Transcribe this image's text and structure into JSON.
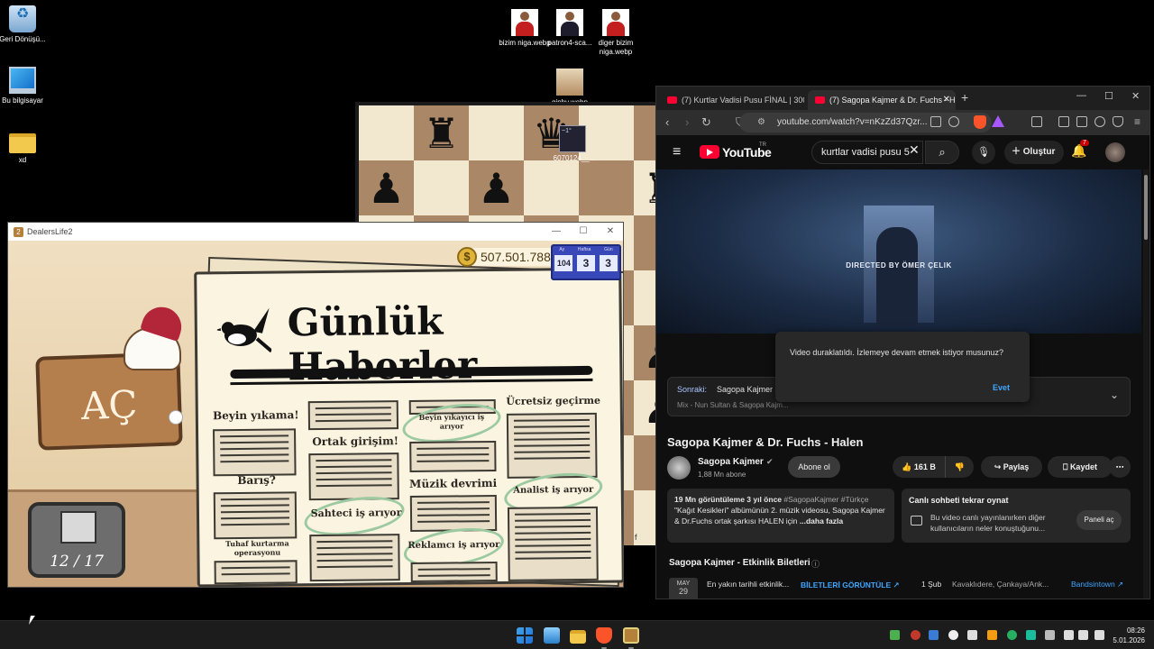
{
  "desktop": {
    "icons": [
      {
        "label": "Geri Dönüşü...",
        "icon": "recycle-bin-icon"
      },
      {
        "label": "Bu bilgisayar",
        "icon": "computer-icon"
      },
      {
        "label": "xd",
        "icon": "folder-icon"
      },
      {
        "label": "bizim niga.webp",
        "icon": "image-file-icon"
      },
      {
        "label": "patron4-sca...",
        "icon": "image-file-icon"
      },
      {
        "label": "diger bizim niga.webp",
        "icon": "image-file-icon"
      },
      {
        "label": "giphy.webp",
        "icon": "image-file-icon"
      }
    ]
  },
  "chess_window": {
    "thumb_label": "6070124__...",
    "thumb_badge": "~1°",
    "footer": "f",
    "board": [
      [
        "",
        "♜",
        "",
        "♛",
        "",
        ""
      ],
      [
        "♟",
        "",
        "♟",
        "",
        "",
        "♜"
      ],
      [
        "",
        "",
        "",
        "",
        "",
        ""
      ],
      [
        "",
        "",
        "",
        "",
        "",
        ""
      ],
      [
        "",
        "",
        "",
        "",
        "",
        "♟"
      ],
      [
        "",
        "",
        "",
        "",
        "",
        "♟"
      ],
      [
        "",
        "",
        "",
        "",
        "",
        ""
      ],
      [
        "",
        "",
        "",
        "",
        "",
        ""
      ]
    ]
  },
  "dealerslife": {
    "title": "DealersLife2",
    "window_controls": {
      "minimize": "—",
      "maximize": "☐",
      "close": "✕"
    },
    "money_symbol": "$",
    "money": "507.501.788",
    "calendar": {
      "labels": [
        "Ay",
        "Haftsa",
        "Gün"
      ],
      "values": [
        "104",
        "3",
        "3"
      ]
    },
    "open_sign": "AÇ",
    "inventory_count": "12 / 17",
    "newspaper": {
      "title": "Günlük Haberler",
      "headlines": [
        "Beyin yıkama!",
        "Ortak girişim!",
        "Beyin yıkayıcı iş arıyor",
        "Ücretsiz geçirme",
        "Barış?",
        "Müzik devrimi",
        "Sahteci iş arıyor",
        "Analist iş arıyor",
        "Tuhaf kurtarma operasyonu",
        "Reklamcı iş arıyor"
      ]
    }
  },
  "browser": {
    "tabs": [
      {
        "label": "(7) Kurtlar Vadisi Pusu FİNAL | 300. Bö",
        "active": false
      },
      {
        "label": "(7) Sagopa Kajmer & Dr. Fuchs - H",
        "active": true
      }
    ],
    "new_tab": "+",
    "window_controls": {
      "minimize": "—",
      "maximize": "☐",
      "close": "✕"
    },
    "url": "youtube.com/watch?v=nKzZd37Qzr...",
    "youtube": {
      "brand": "YouTube",
      "region": "TR",
      "search_value": "kurtlar vadisi pusu 5",
      "create_label": "Oluştur",
      "notif_count": "7",
      "video_overlay": "DIRECTED BY ÖMER ÇELIK",
      "next_label": "Sonraki:",
      "next_title": "Sagopa Kajmer - S",
      "next_sub": "Mix - Nun Sultan & Sagopa Kajm...",
      "pause_prompt": "Video duraklatıldı. İzlemeye devam etmek istiyor musunuz?",
      "pause_yes": "Evet",
      "video_title": "Sagopa Kajmer & Dr. Fuchs - Halen",
      "channel": "Sagopa Kajmer",
      "subscribers": "1,88 Mn abone",
      "subscribe": "Abone ol",
      "likes": "161 B",
      "share": "Paylaş",
      "save": "Kaydet",
      "desc_stats": "19 Mn görüntüleme  3 yıl önce",
      "desc_tags": "#SagopaKajmer #Türkçe",
      "desc_body": "\"Kağıt Kesikleri\" albümünün 2. müzik videosu, Sagopa Kajmer & Dr.Fuchs ortak şarkısı HALEN için",
      "desc_more": "...daha fazla",
      "chat_title": "Canlı sohbeti tekrar oynat",
      "chat_text": "Bu video canlı yayınlanırken diğer kullanıcıların neler konuştuğunu...",
      "chat_button": "Paneli aç",
      "events_title": "Sagopa Kajmer - Etkinlik Biletleri",
      "event_month": "MAY",
      "event_day": "29",
      "event_text": "En yakın tarihli etkinlik...",
      "event_button": "BİLETLERİ GÖRÜNTÜLE ↗",
      "event2_date": "1 Şub",
      "event2_place": "Kavaklıdere, Çankaya/Ank...",
      "event2_vendor": "Bandsintown ↗"
    }
  },
  "taskbar": {
    "time": "08:26",
    "date": "5.01.2026"
  }
}
